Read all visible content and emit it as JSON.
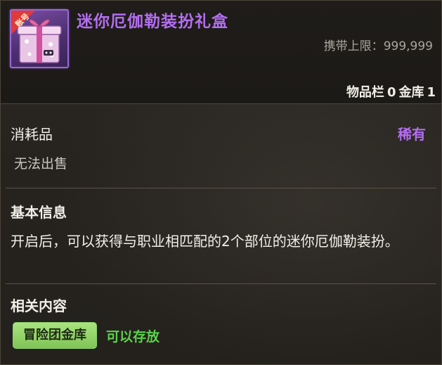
{
  "item": {
    "name": "迷你厄伽勒装扮礼盒",
    "icon": "gift-box-icon",
    "icon_badge": "账号",
    "name_color": "#b36ef0"
  },
  "header": {
    "carry_limit_label": "携带上限：",
    "carry_limit_value": "999,999",
    "inventory_label": "物品栏",
    "inventory_value": "0",
    "vault_label": "金库",
    "vault_value": "1"
  },
  "category": {
    "type": "消耗品",
    "rarity": "稀有",
    "rarity_color": "#b36ef0",
    "sell_status": "无法出售"
  },
  "basic_info": {
    "title": "基本信息",
    "description": "开启后，可以获得与职业相匹配的2个部位的迷你厄伽勒装扮。"
  },
  "related": {
    "title": "相关内容",
    "button_label": "冒险团金库",
    "status": "可以存放",
    "status_color": "#5bd34a"
  }
}
